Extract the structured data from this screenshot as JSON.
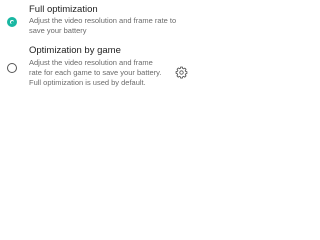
{
  "options": [
    {
      "title": "Full optimization",
      "description_lines": [
        "Adjust the video resolution and frame rate to",
        "save your battery"
      ],
      "selected": true
    },
    {
      "title": "Optimization by game",
      "description_lines": [
        "Adjust the video resolution and frame",
        "rate for each game to save your battery.",
        "Full optimization is used by default."
      ],
      "selected": false,
      "settings_icon": "gear-icon"
    }
  ],
  "colors": {
    "accent": "#19b7a2",
    "title": "#222222",
    "description": "#6b6b6b",
    "background": "#ffffff"
  }
}
